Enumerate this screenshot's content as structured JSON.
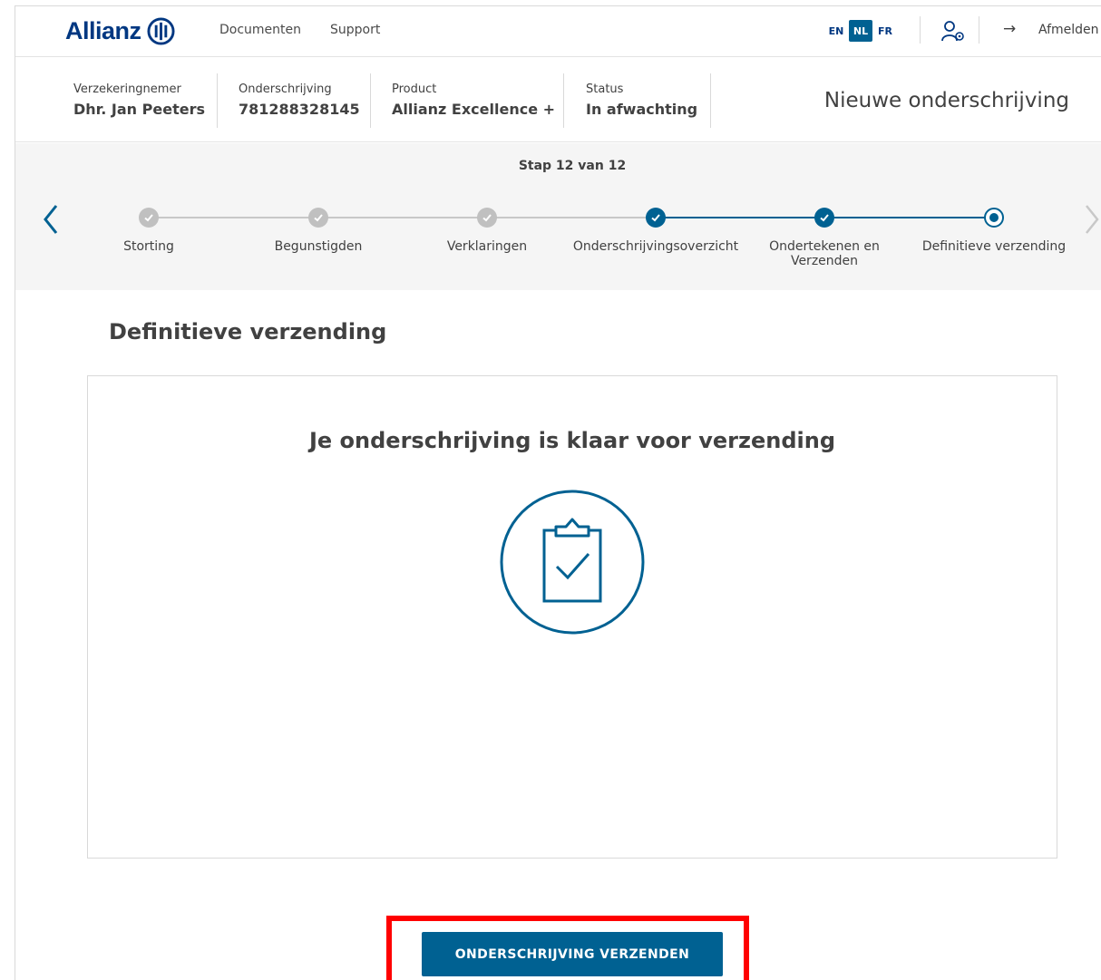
{
  "header": {
    "brand": "Allianz",
    "nav": [
      "Documenten",
      "Support"
    ],
    "languages": [
      {
        "code": "EN",
        "active": false
      },
      {
        "code": "NL",
        "active": true
      },
      {
        "code": "FR",
        "active": false
      }
    ],
    "logout_label": "Afmelden",
    "icons": {
      "user_settings": "user-settings-icon",
      "logout": "arrow-right-icon"
    }
  },
  "info": {
    "policyholder": {
      "label": "Verzekeringnemer",
      "value": "Dhr. Jan Peeters"
    },
    "subscription": {
      "label": "Onderschrijving",
      "value": "781288328145"
    },
    "product": {
      "label": "Product",
      "value": "Allianz Excellence +"
    },
    "status": {
      "label": "Status",
      "value": "In afwachting"
    },
    "page_title": "Nieuwe onderschrijving"
  },
  "stepper": {
    "counter": "Stap 12 van 12",
    "steps": [
      {
        "label": "Storting",
        "state": "done"
      },
      {
        "label": "Begunstigden",
        "state": "done"
      },
      {
        "label": "Verklaringen",
        "state": "done"
      },
      {
        "label": "Onderschrijvingsoverzicht",
        "state": "active"
      },
      {
        "label": "Ondertekenen en Verzenden",
        "state": "active"
      },
      {
        "label": "Definitieve verzending",
        "state": "current"
      }
    ]
  },
  "main": {
    "section_title": "Definitieve verzending",
    "card_title": "Je onderschrijving is klaar voor verzending",
    "submit_label": "ONDERSCHRIJVING VERZENDEN"
  },
  "colors": {
    "brand_blue": "#003781",
    "accent_blue": "#006192",
    "done_gray": "#c0c0c0",
    "highlight_red": "#ff0000"
  }
}
